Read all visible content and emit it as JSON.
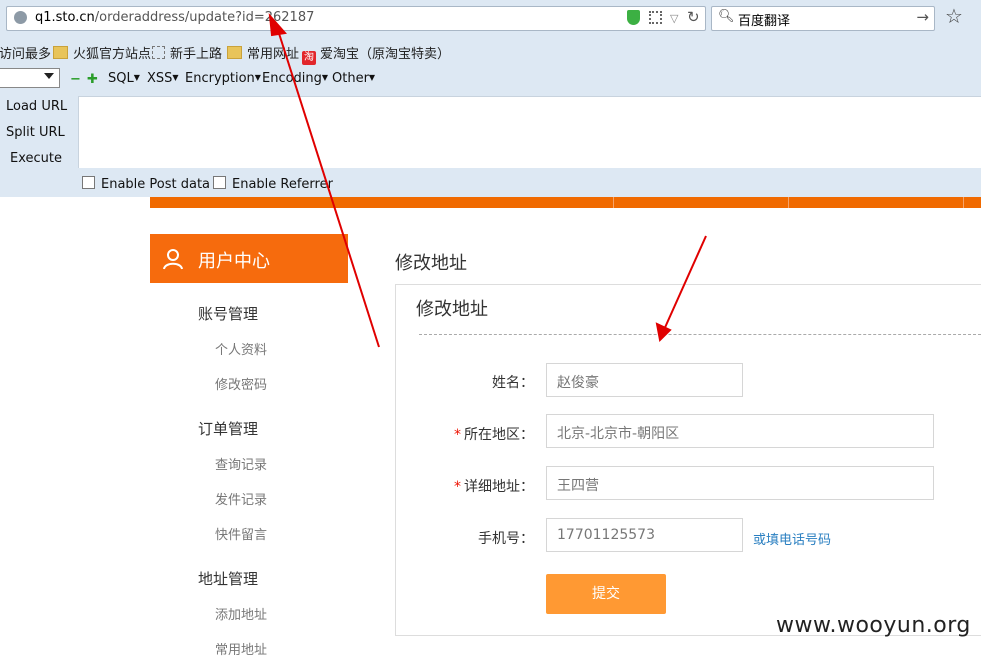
{
  "browser": {
    "url_host": "q1.sto.cn",
    "url_path": "/orderaddress/update?id=262187",
    "search_text": "百度翻译",
    "bookmarks": [
      "访问最多",
      "火狐官方站点",
      "新手上路",
      "常用网址",
      "爱淘宝（原淘宝特卖）"
    ],
    "tao_badge": "淘"
  },
  "hackbar": {
    "menus": [
      "SQL",
      "XSS",
      "Encryption",
      "Encoding",
      "Other"
    ],
    "buttons": [
      "Load URL",
      "Split URL",
      "Execute"
    ],
    "checkboxes": [
      "Enable Post data",
      "Enable Referrer"
    ]
  },
  "sidebar": {
    "title": "用户中心",
    "sections": [
      {
        "title": "账号管理",
        "items": [
          "个人资料",
          "修改密码"
        ]
      },
      {
        "title": "订单管理",
        "items": [
          "查询记录",
          "发件记录",
          "快件留言"
        ]
      },
      {
        "title": "地址管理",
        "items": [
          "添加地址",
          "常用地址"
        ]
      }
    ]
  },
  "main": {
    "breadcrumb": "修改地址",
    "panel_title": "修改地址",
    "form": {
      "name_label": "姓名：",
      "name_value": "赵俊豪",
      "region_label": "所在地区：",
      "region_value": "北京-北京市-朝阳区",
      "address_label": "详细地址：",
      "address_value": "王四营",
      "phone_label": "手机号：",
      "phone_value": "17701125573",
      "phone_alt_link": "或填电话号码",
      "submit_label": "提交",
      "required_mark": "*"
    }
  },
  "watermark": "www.wooyun.org",
  "colors": {
    "accent": "#f66b0d",
    "submit": "#ff9933",
    "link": "#2a7fc1",
    "arrow": "#e00000"
  }
}
